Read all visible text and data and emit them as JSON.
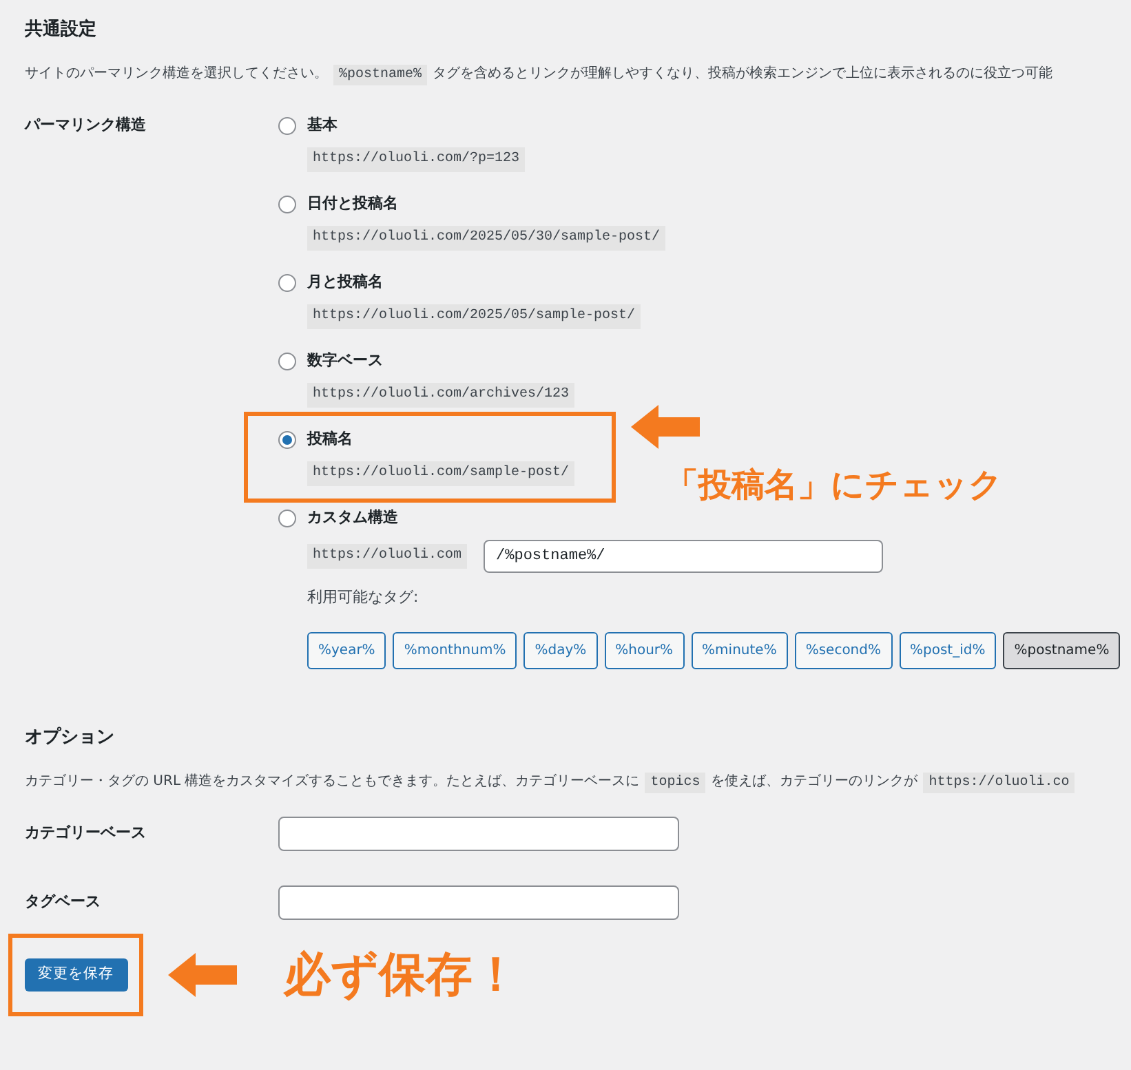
{
  "common": {
    "title": "共通設定",
    "description": [
      {
        "kind": "text",
        "text": "サイトのパーマリンク構造を選択してください。"
      },
      {
        "kind": "code",
        "text": "%postname%"
      },
      {
        "kind": "text",
        "text": "タグを含めるとリンクが理解しやすくなり、投稿が検索エンジンで上位に表示されるのに役立つ可能"
      }
    ],
    "permalink_label": "パーマリンク構造",
    "options": [
      {
        "kind": "preset",
        "label": "基本",
        "example": "https://oluoli.com/?p=123",
        "selected": false
      },
      {
        "kind": "preset",
        "label": "日付と投稿名",
        "example": "https://oluoli.com/2025/05/30/sample-post/",
        "selected": false
      },
      {
        "kind": "preset",
        "label": "月と投稿名",
        "example": "https://oluoli.com/2025/05/sample-post/",
        "selected": false
      },
      {
        "kind": "preset",
        "label": "数字ベース",
        "example": "https://oluoli.com/archives/123",
        "selected": false
      },
      {
        "kind": "preset",
        "label": "投稿名",
        "example": "https://oluoli.com/sample-post/",
        "selected": true
      },
      {
        "kind": "custom",
        "label": "カスタム構造",
        "example": "https://oluoli.com",
        "value": "/%postname%/",
        "selected": false
      }
    ],
    "tags_label": "利用可能なタグ:",
    "tags": [
      {
        "label": "%year%",
        "selected": false
      },
      {
        "label": "%monthnum%",
        "selected": false
      },
      {
        "label": "%day%",
        "selected": false
      },
      {
        "label": "%hour%",
        "selected": false
      },
      {
        "label": "%minute%",
        "selected": false
      },
      {
        "label": "%second%",
        "selected": false
      },
      {
        "label": "%post_id%",
        "selected": false
      },
      {
        "label": "%postname%",
        "selected": true
      }
    ]
  },
  "optional": {
    "title": "オプション",
    "description": [
      {
        "kind": "text",
        "text": "カテゴリー・タグの URL 構造をカスタマイズすることもできます。たとえば、カテゴリーベースに"
      },
      {
        "kind": "code",
        "text": "topics"
      },
      {
        "kind": "text",
        "text": "を使えば、カテゴリーのリンクが"
      },
      {
        "kind": "code",
        "text": "https://oluoli.co"
      }
    ],
    "fields": [
      {
        "label": "カテゴリーベース"
      },
      {
        "label": "タグベース"
      }
    ]
  },
  "save_button": "変更を保存",
  "annotations": {
    "check_note": "「投稿名」にチェック",
    "save_note": "必ず保存！"
  }
}
